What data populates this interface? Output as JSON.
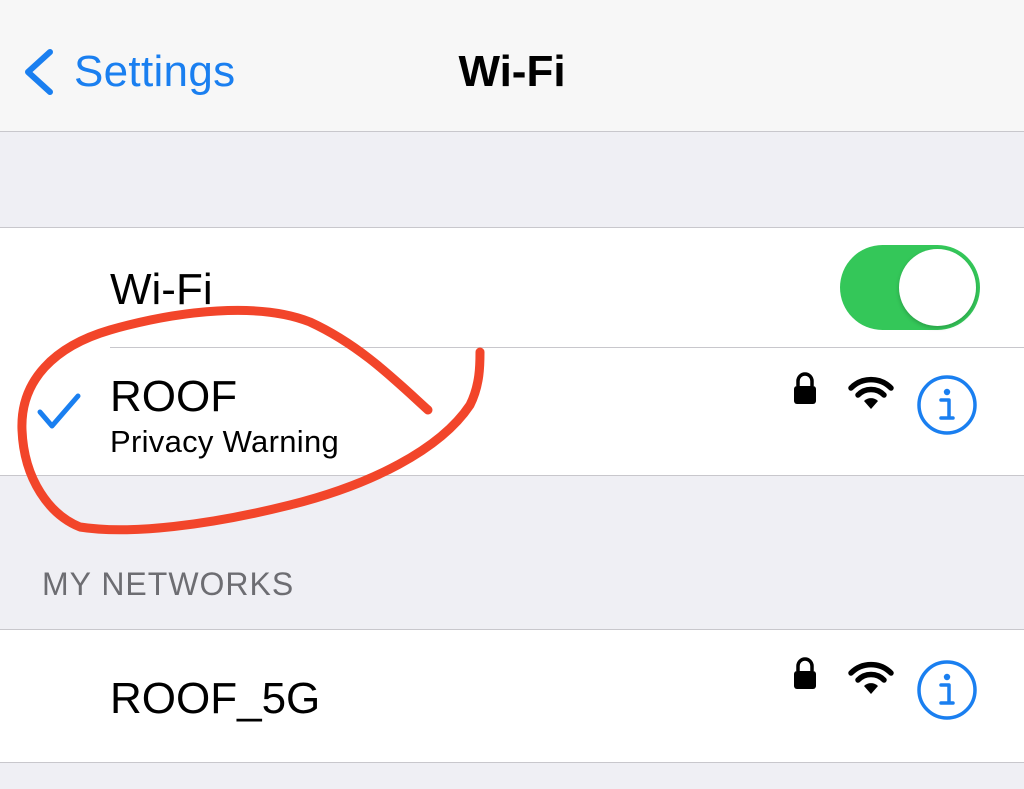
{
  "nav": {
    "back_label": "Settings",
    "title": "Wi-Fi"
  },
  "wifi_toggle": {
    "label": "Wi-Fi",
    "enabled": true
  },
  "current_network": {
    "name": "ROOF",
    "subtitle": "Privacy Warning",
    "connected": true,
    "secured": true
  },
  "my_networks": {
    "header": "MY NETWORKS",
    "items": [
      {
        "name": "ROOF_5G",
        "secured": true
      }
    ]
  },
  "colors": {
    "accent": "#1a7ff0",
    "toggle_on": "#34c759",
    "annotation": "#f2452a",
    "background": "#efeff4"
  },
  "icons": {
    "back": "chevron-left-icon",
    "check": "checkmark-icon",
    "lock": "lock-icon",
    "signal": "wifi-signal-icon",
    "info": "info-icon"
  }
}
